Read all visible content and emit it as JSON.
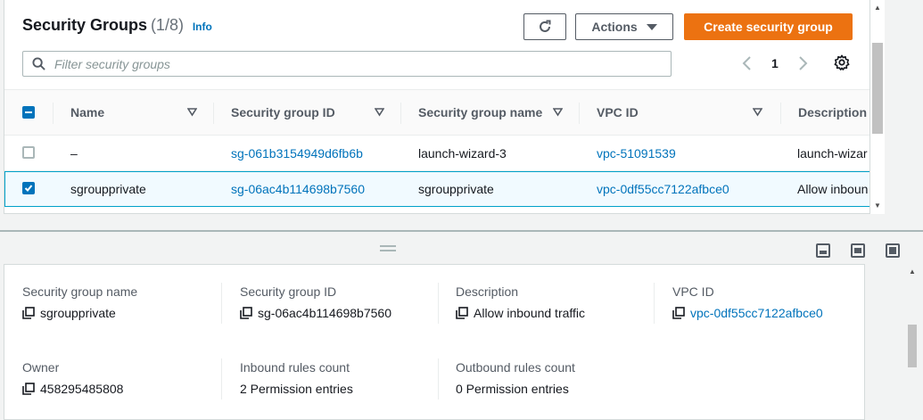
{
  "header": {
    "title": "Security Groups",
    "count": "(1/8)",
    "info": "Info"
  },
  "toolbar": {
    "actions_label": "Actions",
    "create_label": "Create security group"
  },
  "search": {
    "placeholder": "Filter security groups"
  },
  "pagination": {
    "current_page": "1"
  },
  "table": {
    "columns": [
      "Name",
      "Security group ID",
      "Security group name",
      "VPC ID",
      "Description"
    ],
    "rows": [
      {
        "selected": false,
        "name": "–",
        "sg_id": "sg-061b3154949d6fb6b",
        "sg_name": "launch-wizard-3",
        "vpc_id": "vpc-51091539",
        "description": "launch-wizar"
      },
      {
        "selected": true,
        "name": "sgroupprivate",
        "sg_id": "sg-06ac4b114698b7560",
        "sg_name": "sgroupprivate",
        "vpc_id": "vpc-0df55cc7122afbce0",
        "description": "Allow inboun"
      }
    ]
  },
  "details": {
    "sg_name_label": "Security group name",
    "sg_name_value": "sgroupprivate",
    "sg_id_label": "Security group ID",
    "sg_id_value": "sg-06ac4b114698b7560",
    "description_label": "Description",
    "description_value": "Allow inbound traffic",
    "vpc_label": "VPC ID",
    "vpc_value": "vpc-0df55cc7122afbce0",
    "owner_label": "Owner",
    "owner_value": "458295485808",
    "inbound_label": "Inbound rules count",
    "inbound_value": "2 Permission entries",
    "outbound_label": "Outbound rules count",
    "outbound_value": "0 Permission entries"
  },
  "colors": {
    "primary": "#ec7211",
    "link": "#0073bb",
    "selected_row_bg": "#f1faff",
    "selected_row_border": "#00a1c9"
  }
}
